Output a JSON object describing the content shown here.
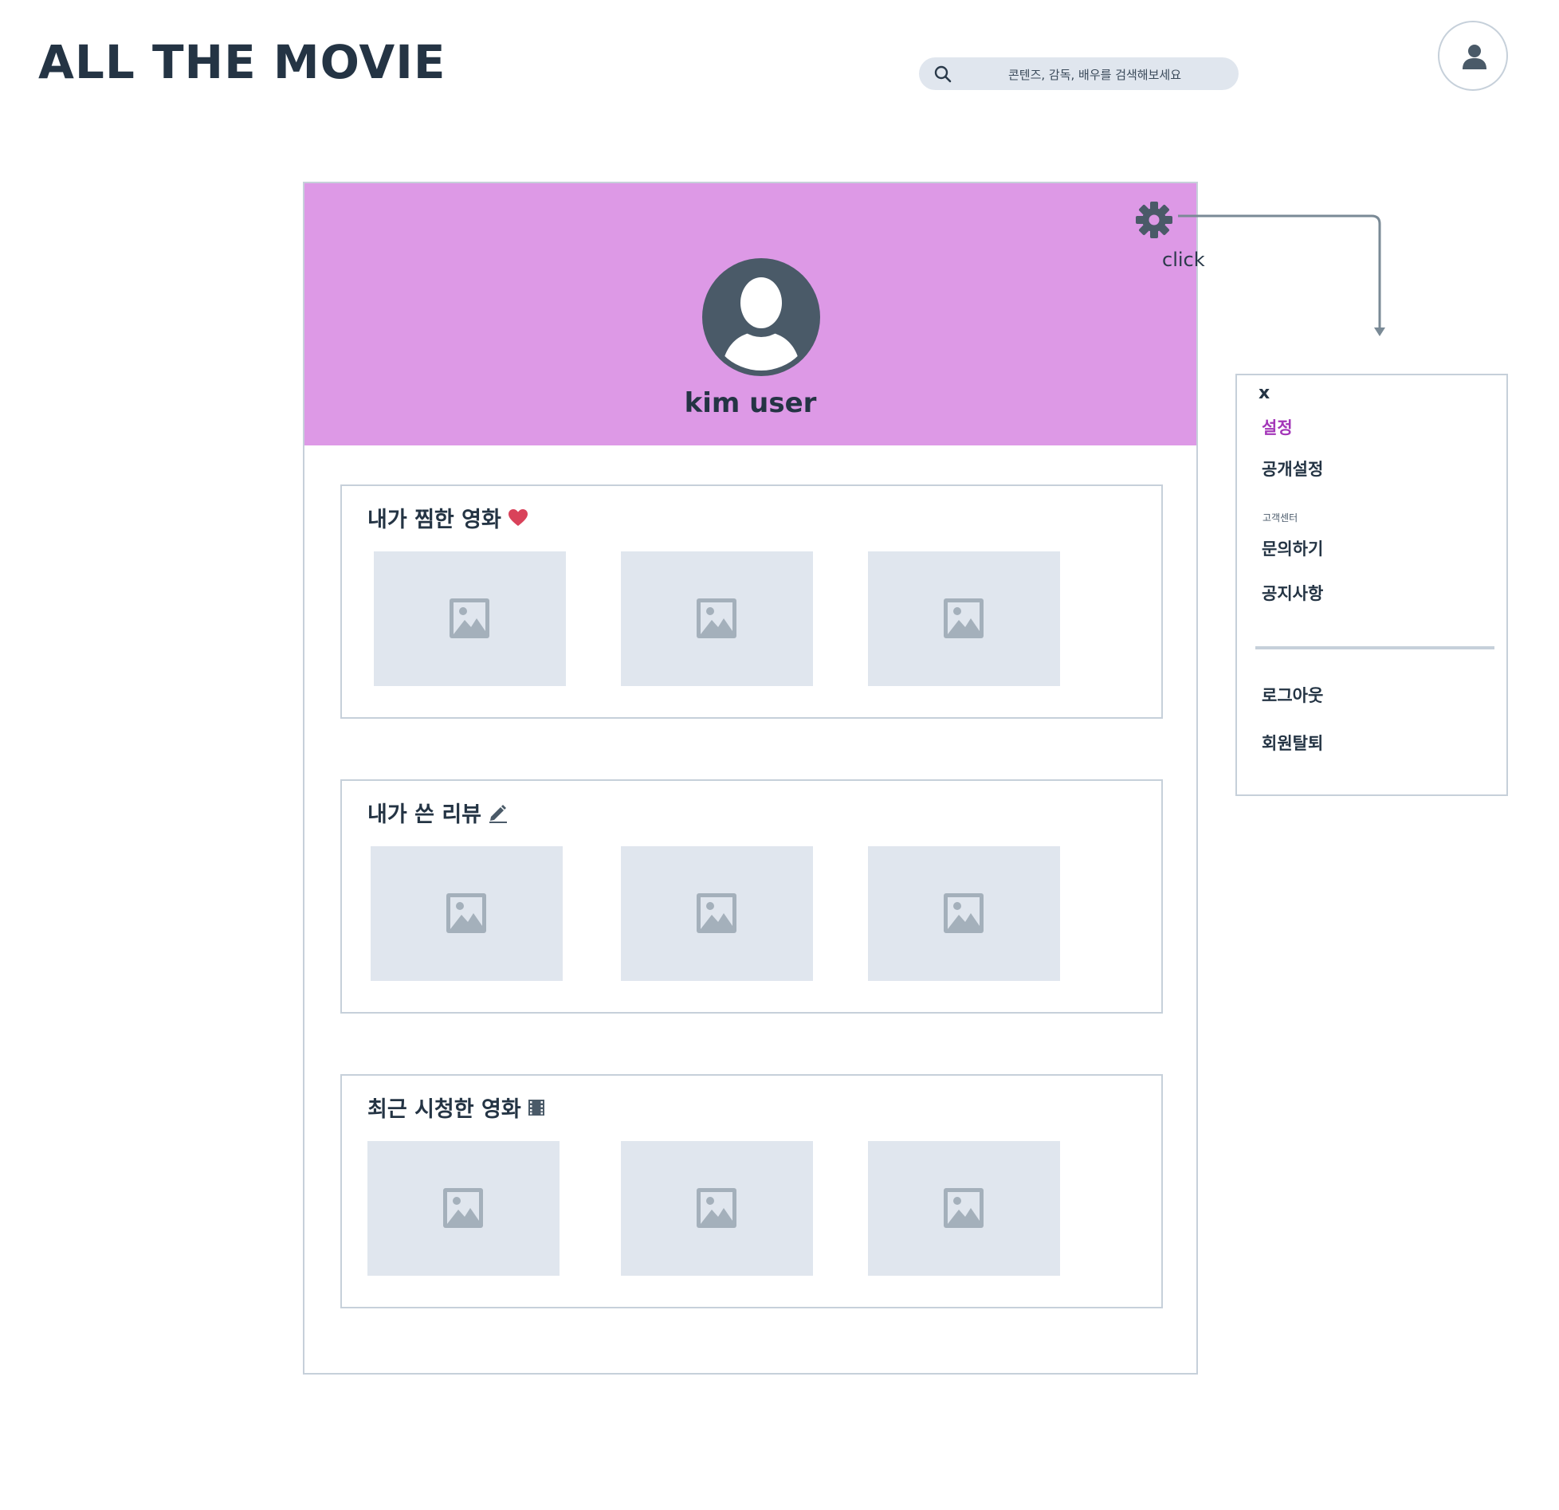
{
  "header": {
    "logo": "ALL THE MOVIE",
    "search_placeholder": "콘텐즈, 감독, 배우를 검색해보세요"
  },
  "profile": {
    "username": "kim user",
    "banner_color": "#dd99e6"
  },
  "sections": [
    {
      "title": "내가 찜한 영화",
      "icon": "heart-icon",
      "thumbnails": 3
    },
    {
      "title": "내가 쓴 리뷰",
      "icon": "pencil-icon",
      "thumbnails": 3
    },
    {
      "title": "최근 시청한 영화",
      "icon": "film-icon",
      "thumbnails": 3
    }
  ],
  "annotation": {
    "click_label": "click"
  },
  "settings_menu": {
    "close_label": "x",
    "title": "설정",
    "items": {
      "privacy": "공개설정",
      "category": "고객센터",
      "inquiry": "문의하기",
      "notice": "공지사항",
      "logout": "로그아웃",
      "withdraw": "회원탈퇴"
    }
  },
  "colors": {
    "accent": "#a336b8",
    "heart": "#d9425a",
    "text": "#243444",
    "placeholder_bg": "#e0e6ee"
  }
}
